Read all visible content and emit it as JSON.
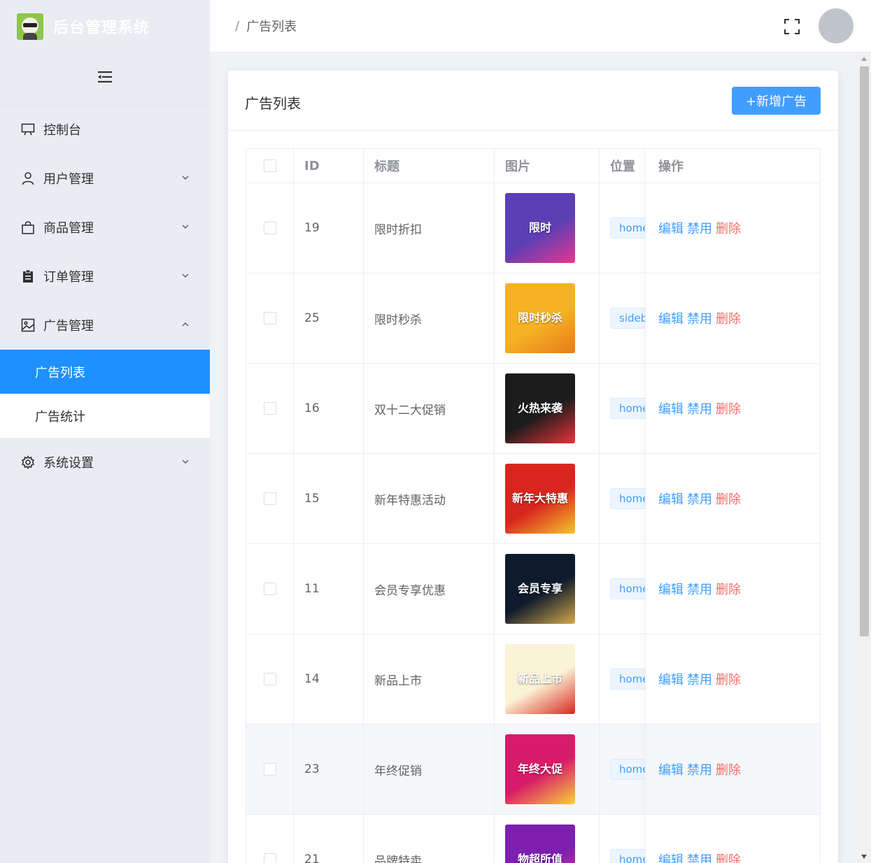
{
  "app": {
    "title": "后台管理系统"
  },
  "header": {
    "breadcrumb_sep": "/",
    "breadcrumb_current": "广告列表"
  },
  "sidebar": {
    "items": [
      {
        "label": "控制台",
        "icon": "monitor-icon"
      },
      {
        "label": "用户管理",
        "icon": "user-icon",
        "expandable": true
      },
      {
        "label": "商品管理",
        "icon": "shopping-bag-icon",
        "expandable": true
      },
      {
        "label": "订单管理",
        "icon": "clipboard-icon",
        "expandable": true
      },
      {
        "label": "广告管理",
        "icon": "picture-icon",
        "expandable": true,
        "expanded": true
      },
      {
        "label": "系统设置",
        "icon": "gear-icon",
        "expandable": true
      }
    ],
    "ad_children": [
      {
        "label": "广告列表",
        "active": true
      },
      {
        "label": "广告统计",
        "active": false
      }
    ],
    "active_color": "#1e90ff"
  },
  "card": {
    "title": "广告列表",
    "add_button": "+新增广告"
  },
  "table": {
    "headers": {
      "id": "ID",
      "title": "标题",
      "image": "图片",
      "position": "位置",
      "ops": "操作"
    },
    "ops": {
      "edit": "编辑",
      "disable": "禁用",
      "delete": "删除"
    },
    "rows": [
      {
        "id": "19",
        "title": "限时折扣",
        "position": "home",
        "thumb_text": "限时",
        "thumb_bg": "#5b3fb5",
        "thumb_accent": "#e8368f"
      },
      {
        "id": "25",
        "title": "限时秒杀",
        "position": "sidebar",
        "thumb_text": "限时秒杀",
        "thumb_bg": "#f5b324",
        "thumb_accent": "#e87a1a"
      },
      {
        "id": "16",
        "title": "双十二大促销",
        "position": "home",
        "thumb_text": "火热来袭",
        "thumb_bg": "#1c1c1c",
        "thumb_accent": "#e8333a"
      },
      {
        "id": "15",
        "title": "新年特惠活动",
        "position": "home",
        "thumb_text": "新年大特惠",
        "thumb_bg": "#d8261f",
        "thumb_accent": "#f7c52c"
      },
      {
        "id": "11",
        "title": "会员专享优惠",
        "position": "home",
        "thumb_text": "会员专享",
        "thumb_bg": "#0f1a2c",
        "thumb_accent": "#d4a94a"
      },
      {
        "id": "14",
        "title": "新品上市",
        "position": "home",
        "thumb_text": "新品上市",
        "thumb_bg": "#fbf3d6",
        "thumb_accent": "#d8281f"
      },
      {
        "id": "23",
        "title": "年终促销",
        "position": "home",
        "thumb_text": "年终大促",
        "thumb_bg": "#d81b6a",
        "thumb_accent": "#f9d13b"
      },
      {
        "id": "21",
        "title": "品牌特卖",
        "position": "home",
        "thumb_text": "物超所值",
        "thumb_bg": "#7e1fb0",
        "thumb_accent": "#e63a8a"
      }
    ]
  },
  "colors": {
    "primary": "#409eff",
    "danger": "#f56c6c"
  }
}
